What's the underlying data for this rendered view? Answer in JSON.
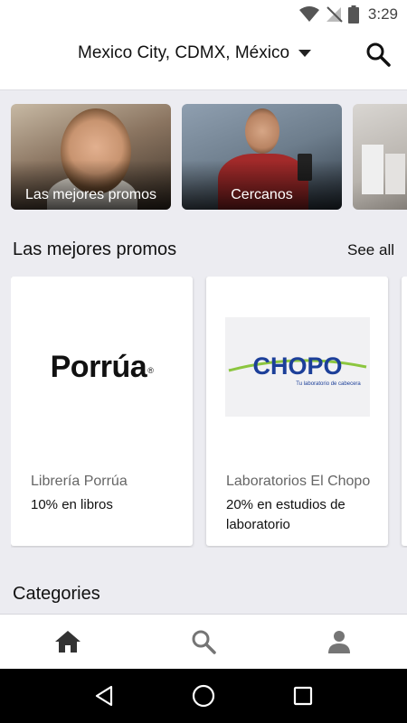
{
  "status_bar": {
    "time": "3:29"
  },
  "header": {
    "location": "Mexico City, CDMX, México"
  },
  "carousel": [
    {
      "label": "Las mejores promos"
    },
    {
      "label": "Cercanos"
    },
    {
      "label": ""
    }
  ],
  "best_promos": {
    "title": "Las mejores promos",
    "see_all": "See all",
    "cards": [
      {
        "logo_text": "Porrúa",
        "logo_mark": "®",
        "name": "Librería Porrúa",
        "offer": "10% en libros"
      },
      {
        "logo_text": "CHOPO",
        "logo_tagline": "Tu laboratorio de cabecera",
        "name": "Laboratorios El Chopo",
        "offer": "20% en estudios de laboratorio"
      }
    ]
  },
  "categories": {
    "title": "Categories"
  },
  "bottom_nav": [
    {
      "icon": "home-icon"
    },
    {
      "icon": "search-icon"
    },
    {
      "icon": "person-icon"
    }
  ],
  "colors": {
    "chopo_blue": "#1c3f99",
    "chopo_green": "#8cc63f",
    "icon_dark": "#333333",
    "icon_gray": "#757575"
  }
}
